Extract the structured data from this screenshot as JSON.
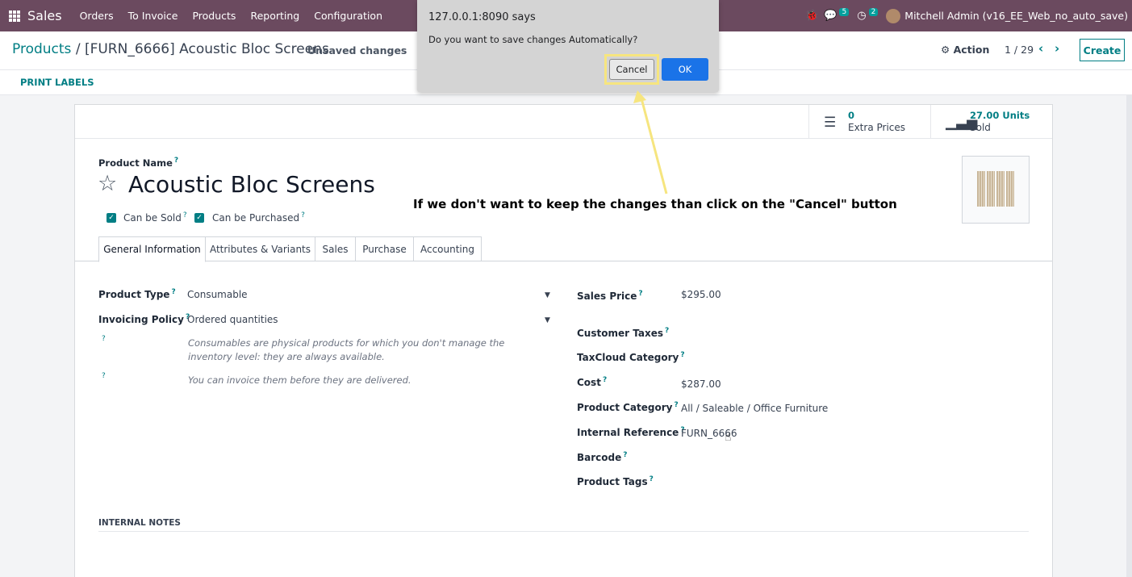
{
  "navbar": {
    "app_name": "Sales",
    "menu": [
      "Orders",
      "To Invoice",
      "Products",
      "Reporting",
      "Configuration"
    ],
    "messages_count": "5",
    "activities_count": "2",
    "user": "Mitchell Admin (v16_EE_Web_no_auto_save)"
  },
  "control_panel": {
    "breadcrumb_root": "Products",
    "breadcrumb_separator": "/",
    "breadcrumb_current": "[FURN_6666] Acoustic Bloc Screens",
    "unsaved": "Unsaved changes",
    "action": "Action",
    "pager": "1 / 29",
    "create": "Create"
  },
  "statusbar": {
    "print_labels": "PRINT LABELS"
  },
  "stat_buttons": {
    "extra_prices_value": "0",
    "extra_prices_label": "Extra Prices",
    "sold_value": "27.00 Units",
    "sold_label": "Sold"
  },
  "product": {
    "name_label": "Product Name",
    "name": "Acoustic Bloc Screens",
    "can_be_sold": "Can be Sold",
    "can_be_purchased": "Can be Purchased",
    "help": "?"
  },
  "tabs": [
    "General Information",
    "Attributes & Variants",
    "Sales",
    "Purchase",
    "Accounting"
  ],
  "left_fields": {
    "product_type_label": "Product Type",
    "product_type_value": "Consumable",
    "invoicing_policy_label": "Invoicing Policy",
    "invoicing_policy_value": "Ordered quantities",
    "note1": "Consumables are physical products for which you don't manage the inventory level: they are always available.",
    "note2": "You can invoice them before they are delivered."
  },
  "right_fields": {
    "sales_price_label": "Sales Price",
    "sales_price_value": "$295.00",
    "customer_taxes_label": "Customer Taxes",
    "taxcloud_label": "TaxCloud Category",
    "cost_label": "Cost",
    "cost_value": "$287.00",
    "category_label": "Product Category",
    "category_value": "All / Saleable / Office Furniture",
    "internal_ref_label": "Internal Reference",
    "internal_ref_value": "FURN_6666",
    "barcode_label": "Barcode",
    "tags_label": "Product Tags"
  },
  "internal_notes": "INTERNAL NOTES",
  "dialog": {
    "title": "127.0.0.1:8090 says",
    "message": "Do you want to save changes Automatically?",
    "cancel": "Cancel",
    "ok": "OK"
  },
  "annotation": "If we don't want to keep the changes than click on the \"Cancel\" button",
  "colors": {
    "navbar": "#6b4a5f",
    "accent": "#017e84",
    "highlight": "#f6e57f",
    "ok_button": "#1a73e8"
  }
}
